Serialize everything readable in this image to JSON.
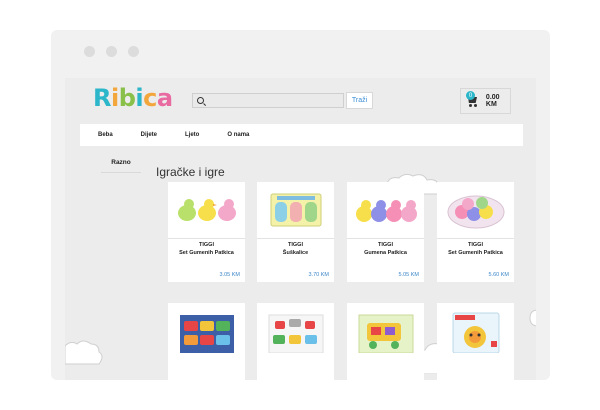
{
  "site": {
    "logo_text": "Ribica"
  },
  "search": {
    "placeholder": "",
    "button_label": "Traži"
  },
  "cart": {
    "badge_count": "0",
    "total": "0.00 KM"
  },
  "nav": {
    "items": [
      "Beba",
      "Dijete",
      "Ljeto",
      "O nama"
    ]
  },
  "sidebar": {
    "category": "Razno"
  },
  "page": {
    "title": "Igračke i igre"
  },
  "products": [
    {
      "brand": "TIGGI",
      "name": "Set Gumenih Patkica",
      "price": "3.05 KM"
    },
    {
      "brand": "TIGGI",
      "name": "Šuškalice",
      "price": "3.70 KM"
    },
    {
      "brand": "TIGGI",
      "name": "Gumena Patkica",
      "price": "5.05 KM"
    },
    {
      "brand": "TIGGI",
      "name": "Set Gumenih Patkica",
      "price": "5.60 KM"
    }
  ],
  "colors": {
    "accent": "#2cb6c9",
    "price": "#3b86c8"
  }
}
